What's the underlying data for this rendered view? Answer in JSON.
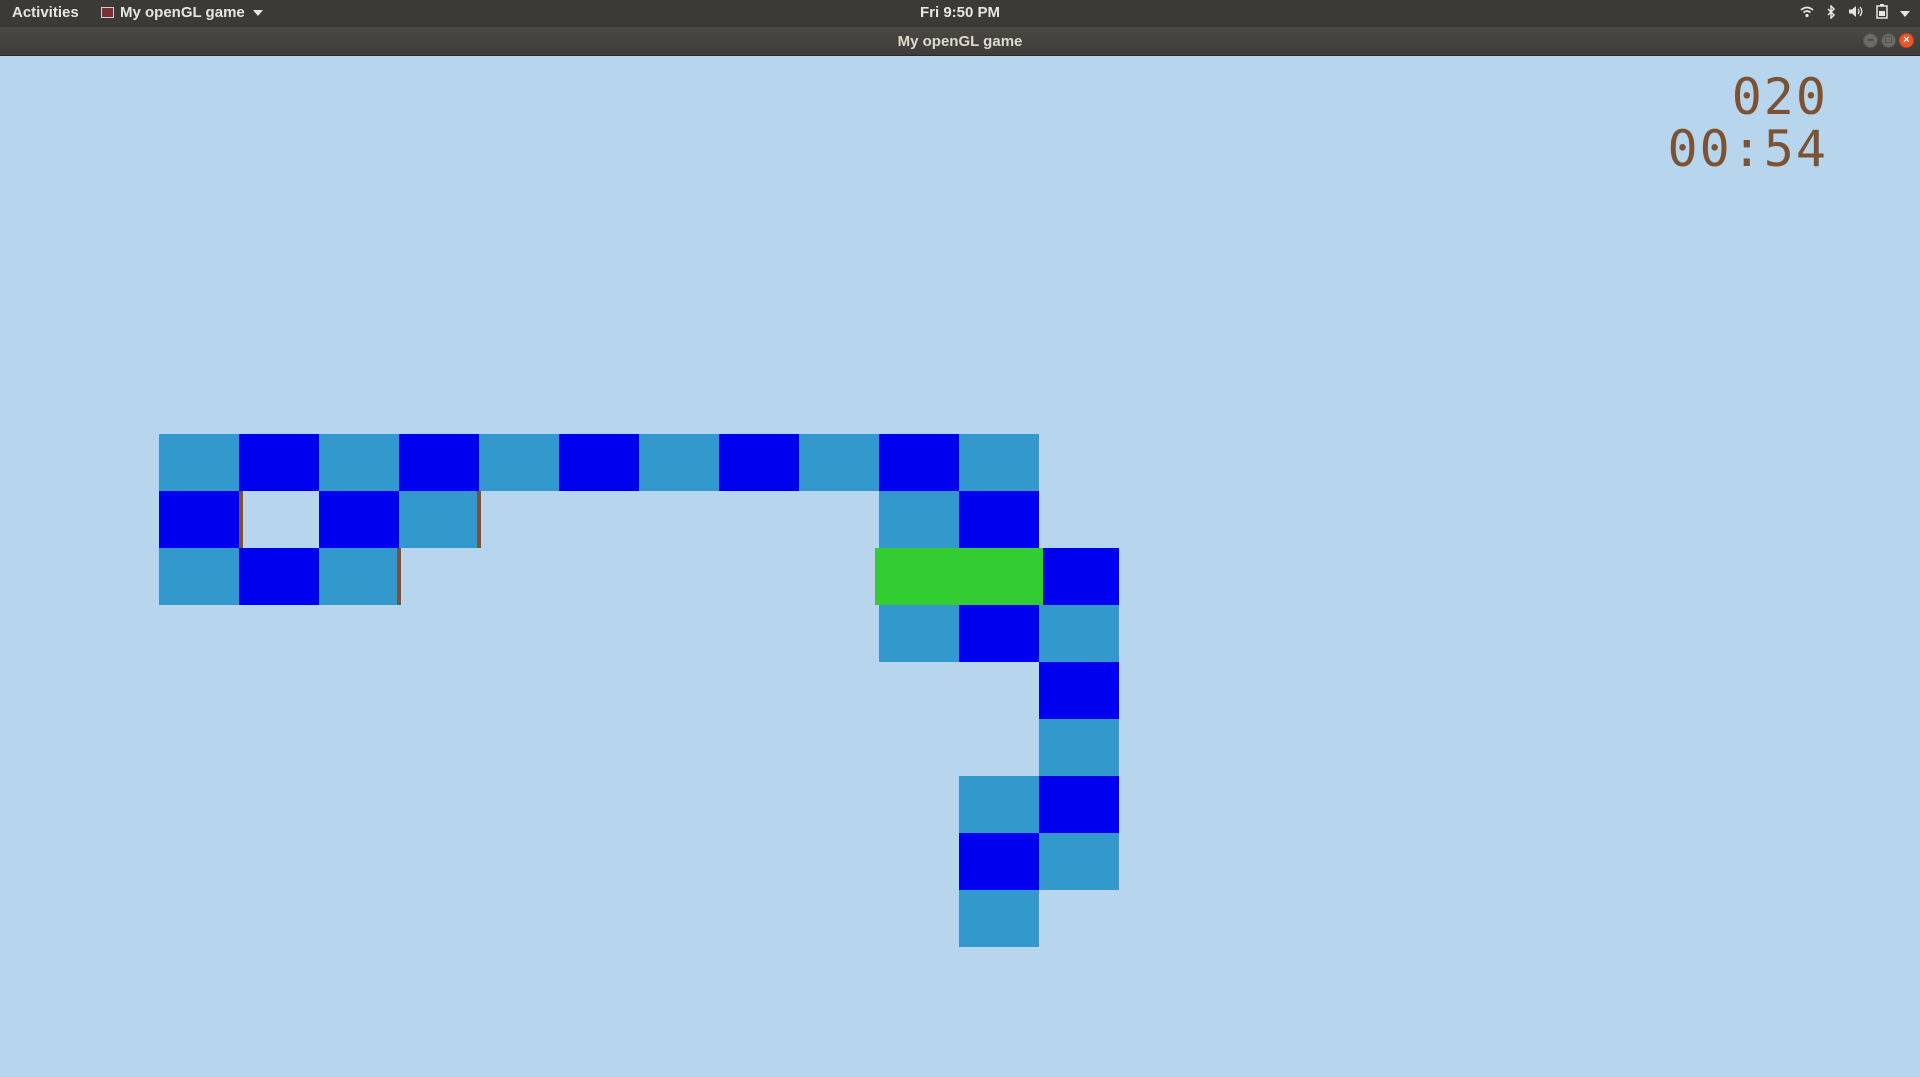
{
  "topbar": {
    "activities_label": "Activities",
    "app_menu_label": "My openGL game",
    "clock": "Fri  9:50 PM",
    "tray_icons": [
      "wifi-icon",
      "bluetooth-icon",
      "volume-icon",
      "battery-icon"
    ]
  },
  "window": {
    "title": "My openGL game",
    "controls": [
      "minimize",
      "maximize",
      "close"
    ]
  },
  "hud": {
    "score": "020",
    "time": "00:54"
  },
  "colors": {
    "background": "#b7d6ee",
    "tile_light": "#3399cc",
    "tile_dark": "#0000ee",
    "player": "#33cc33",
    "edge": "#7b5233",
    "hud_text": "#7b5233"
  },
  "board": {
    "tiles": [
      {
        "col": 0,
        "row": 0,
        "shade": "light"
      },
      {
        "col": 1,
        "row": 0,
        "shade": "dark"
      },
      {
        "col": 2,
        "row": 0,
        "shade": "light"
      },
      {
        "col": 3,
        "row": 0,
        "shade": "dark"
      },
      {
        "col": 4,
        "row": 0,
        "shade": "light"
      },
      {
        "col": 5,
        "row": 0,
        "shade": "dark"
      },
      {
        "col": 6,
        "row": 0,
        "shade": "light"
      },
      {
        "col": 7,
        "row": 0,
        "shade": "dark"
      },
      {
        "col": 8,
        "row": 0,
        "shade": "light"
      },
      {
        "col": 9,
        "row": 0,
        "shade": "dark"
      },
      {
        "col": 10,
        "row": 0,
        "shade": "light"
      },
      {
        "col": 0,
        "row": 1,
        "shade": "dark"
      },
      {
        "col": 2,
        "row": 1,
        "shade": "dark"
      },
      {
        "col": 3,
        "row": 1,
        "shade": "light"
      },
      {
        "col": 9,
        "row": 1,
        "shade": "light"
      },
      {
        "col": 10,
        "row": 1,
        "shade": "dark"
      },
      {
        "col": 0,
        "row": 2,
        "shade": "light"
      },
      {
        "col": 1,
        "row": 2,
        "shade": "dark"
      },
      {
        "col": 2,
        "row": 2,
        "shade": "light"
      },
      {
        "col": 11,
        "row": 2,
        "shade": "dark"
      },
      {
        "col": 9,
        "row": 3,
        "shade": "light"
      },
      {
        "col": 10,
        "row": 3,
        "shade": "dark"
      },
      {
        "col": 11,
        "row": 3,
        "shade": "light"
      },
      {
        "col": 11,
        "row": 4,
        "shade": "dark"
      },
      {
        "col": 11,
        "row": 5,
        "shade": "light"
      },
      {
        "col": 10,
        "row": 6,
        "shade": "light"
      },
      {
        "col": 11,
        "row": 6,
        "shade": "dark"
      },
      {
        "col": 10,
        "row": 7,
        "shade": "dark"
      },
      {
        "col": 11,
        "row": 7,
        "shade": "light"
      },
      {
        "col": 10,
        "row": 8,
        "shade": "light"
      }
    ],
    "player": {
      "col": 9,
      "row": 2,
      "span_cols": 2,
      "orientation": "lying"
    }
  }
}
